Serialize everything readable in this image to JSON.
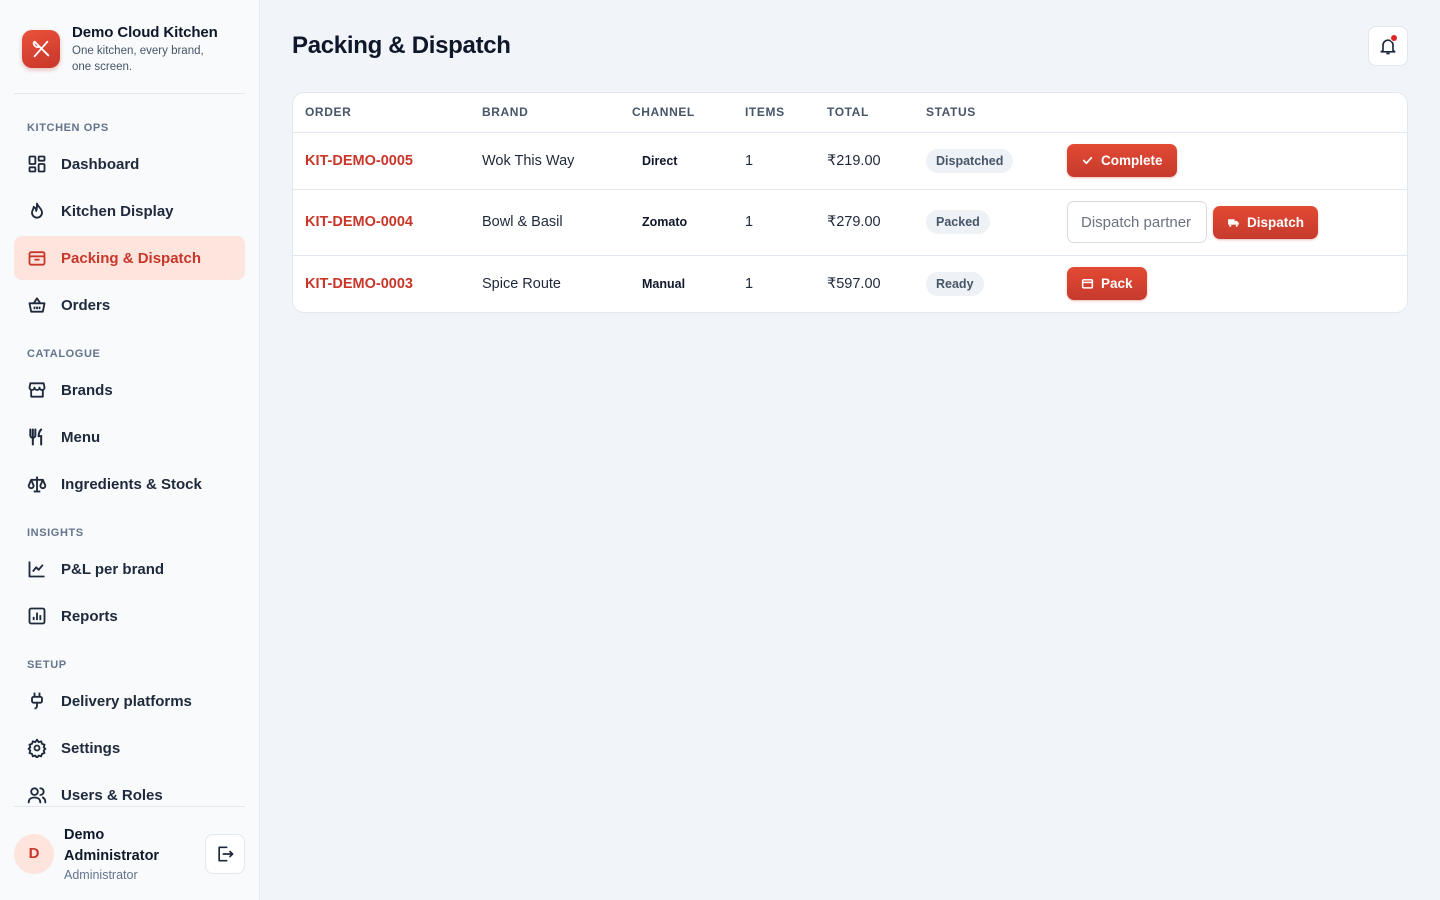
{
  "app": {
    "name": "Demo Cloud Kitchen",
    "tagline": "One kitchen, every brand, one screen."
  },
  "sidebar": {
    "sections": [
      {
        "label": "KITCHEN OPS",
        "items": [
          {
            "label": "Dashboard",
            "icon": "dashboard-icon"
          },
          {
            "label": "Kitchen Display",
            "icon": "flame-icon"
          },
          {
            "label": "Packing & Dispatch",
            "icon": "package-icon",
            "active": true
          },
          {
            "label": "Orders",
            "icon": "basket-icon"
          }
        ]
      },
      {
        "label": "CATALOGUE",
        "items": [
          {
            "label": "Brands",
            "icon": "store-icon"
          },
          {
            "label": "Menu",
            "icon": "utensils-icon"
          },
          {
            "label": "Ingredients & Stock",
            "icon": "scale-icon"
          }
        ]
      },
      {
        "label": "INSIGHTS",
        "items": [
          {
            "label": "P&L per brand",
            "icon": "line-chart-icon"
          },
          {
            "label": "Reports",
            "icon": "bar-chart-icon"
          }
        ]
      },
      {
        "label": "SETUP",
        "items": [
          {
            "label": "Delivery platforms",
            "icon": "plug-icon"
          },
          {
            "label": "Settings",
            "icon": "gear-icon"
          },
          {
            "label": "Users & Roles",
            "icon": "users-icon"
          }
        ]
      }
    ]
  },
  "user": {
    "initial": "D",
    "name": "Demo Administrator",
    "role": "Administrator"
  },
  "page": {
    "title": "Packing & Dispatch"
  },
  "table": {
    "headers": [
      "ORDER",
      "BRAND",
      "CHANNEL",
      "ITEMS",
      "TOTAL",
      "STATUS"
    ],
    "rows": [
      {
        "order": "KIT-DEMO-0005",
        "brand": "Wok This Way",
        "channel": "Direct",
        "items": "1",
        "total": "₹219.00",
        "status": "Dispatched",
        "action": "Complete"
      },
      {
        "order": "KIT-DEMO-0004",
        "brand": "Bowl & Basil",
        "channel": "Zomato",
        "items": "1",
        "total": "₹279.00",
        "status": "Packed",
        "action": "Dispatch",
        "input_placeholder": "Dispatch partner"
      },
      {
        "order": "KIT-DEMO-0003",
        "brand": "Spice Route",
        "channel": "Manual",
        "items": "1",
        "total": "₹597.00",
        "status": "Ready",
        "action": "Pack"
      }
    ]
  },
  "colors": {
    "accent": "#c9362a",
    "accent_light": "#fde4dc",
    "background": "#f1f4f9"
  }
}
